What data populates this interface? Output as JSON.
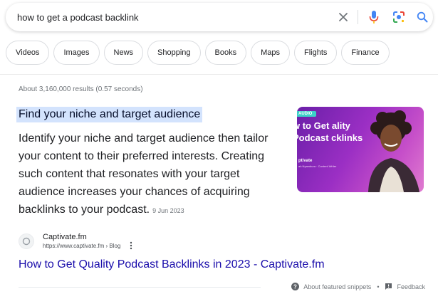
{
  "search": {
    "query": "how to get a podcast backlink"
  },
  "icons": {
    "clear": "close-icon",
    "mic": "microphone-icon",
    "lens": "google-lens-icon",
    "search": "search-icon"
  },
  "chips": [
    "Videos",
    "Images",
    "News",
    "Shopping",
    "Books",
    "Maps",
    "Flights",
    "Finance"
  ],
  "results": {
    "stats": "About 3,160,000 results (0.57 seconds)"
  },
  "featured_snippet": {
    "heading": "Find your niche and target audience",
    "body": "Identify your niche and target audience then tailor your content to their preferred interests. Creating such content that resonates with your target audience increases your chances of acquiring backlinks to your podcast.",
    "date": "9 Jun 2023",
    "thumbnail": {
      "tag": "AUDIO",
      "title": "w to Get ality Podcast cklinks",
      "subtitle": "ptivate",
      "subtitle2": "ah Nyambura · Content Writer"
    },
    "source": {
      "name": "Captivate.fm",
      "url": "https://www.captivate.fm › Blog"
    },
    "link_title": "How to Get Quality Podcast Backlinks in 2023 - Captivate.fm"
  },
  "footer": {
    "about": "About featured snippets",
    "separator": "•",
    "feedback": "Feedback"
  },
  "colors": {
    "link": "#1a0dab",
    "highlight": "#d3e3fd",
    "mic_blue": "#4285f4",
    "mic_red": "#ea4335"
  }
}
